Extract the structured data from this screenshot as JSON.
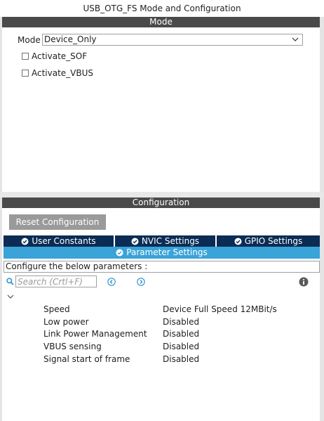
{
  "window": {
    "title": "USB_OTG_FS Mode and Configuration"
  },
  "mode_section": {
    "header": "Mode",
    "mode_label": "Mode",
    "mode_value": "Device_Only",
    "checkboxes": [
      {
        "label": "Activate_SOF",
        "checked": false
      },
      {
        "label": "Activate_VBUS",
        "checked": false
      }
    ]
  },
  "config_section": {
    "header": "Configuration",
    "reset_label": "Reset Configuration",
    "tabs": [
      {
        "label": "User Constants"
      },
      {
        "label": "NVIC Settings"
      },
      {
        "label": "GPIO Settings"
      },
      {
        "label": "Parameter Settings",
        "active": true
      }
    ],
    "info_text": "Configure the below parameters :",
    "search_placeholder": "Search (Crtl+F)",
    "parameters": [
      {
        "name": "Speed",
        "value": "Device Full Speed 12MBit/s"
      },
      {
        "name": "Low power",
        "value": "Disabled"
      },
      {
        "name": "Link Power Management",
        "value": "Disabled"
      },
      {
        "name": "VBUS sensing",
        "value": "Disabled"
      },
      {
        "name": "Signal start of frame",
        "value": "Disabled"
      }
    ]
  },
  "colors": {
    "header_bg": "#4a4a4a",
    "tab_bg": "#0a2c55",
    "tab_active_bg": "#3aa3d8",
    "button_bg": "#9a9a9a",
    "icon_blue": "#2a8fd0"
  }
}
